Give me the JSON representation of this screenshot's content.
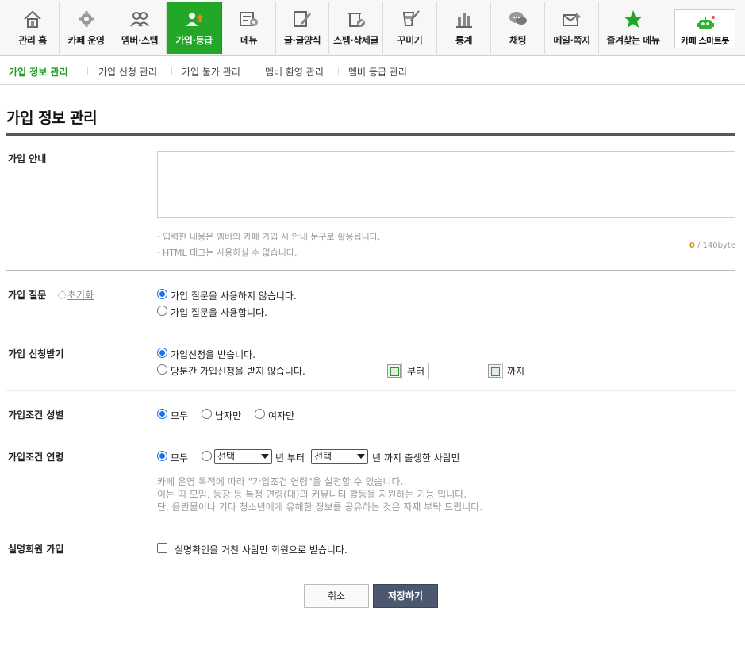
{
  "topnav": {
    "items": [
      {
        "label": "관리 홈",
        "icon": "home-icon"
      },
      {
        "label": "카페 운영",
        "icon": "gear-icon"
      },
      {
        "label": "멤버·스탭",
        "icon": "members-icon"
      },
      {
        "label": "가입·등급",
        "icon": "user-up-icon",
        "active": true
      },
      {
        "label": "메뉴",
        "icon": "menu-settings-icon"
      },
      {
        "label": "글·글양식",
        "icon": "pencil-icon"
      },
      {
        "label": "스팸·삭제글",
        "icon": "trash-icon"
      },
      {
        "label": "꾸미기",
        "icon": "paint-icon"
      },
      {
        "label": "통계",
        "icon": "bar-chart-icon"
      },
      {
        "label": "채팅",
        "icon": "chat-icon"
      },
      {
        "label": "메일·쪽지",
        "icon": "mail-icon"
      },
      {
        "label": "즐겨찾는 메뉴",
        "icon": "star-icon"
      }
    ],
    "smartbot": {
      "label": "카페 스마트봇",
      "icon": "robot-icon"
    },
    "active_color": "#22a826"
  },
  "subnav": {
    "items": [
      "가입 정보 관리",
      "가입 신청 관리",
      "가입 불가 관리",
      "멤버 환영 관리",
      "멤버 등급 관리"
    ],
    "active_index": 0,
    "active_color": "#1f9b22"
  },
  "page": {
    "title": "가입 정보 관리"
  },
  "join_guide": {
    "label": "가입 안내",
    "notes": [
      "· 입력한 내용은 멤버의 카페 가입 시 안내 문구로 활용됩니다.",
      "· HTML 태그는 사용하실 수 없습니다."
    ],
    "byte_count": "0",
    "byte_limit": " / 140byte"
  },
  "join_question": {
    "label": "가입 질문",
    "reset_icon": "refresh-icon",
    "reset_label": "초기화",
    "options": [
      "가입 질문을 사용하지 않습니다.",
      "가입 질문을 사용합니다."
    ],
    "selected": 0
  },
  "join_apply": {
    "label": "가입 신청받기",
    "options": [
      "가입신청을 받습니다.",
      "당분간 가입신청을 받지 않습니다."
    ],
    "selected": 0,
    "from_label": "부터",
    "to_label": "까지",
    "from_date": "",
    "to_date": ""
  },
  "gender": {
    "label": "가입조건 성별",
    "options": [
      "모두",
      "남자만",
      "여자만"
    ],
    "selected": 0
  },
  "age": {
    "label": "가입조건 연령",
    "options": [
      "모두"
    ],
    "selected": 0,
    "select_start": "선택",
    "select_end": "선택",
    "text_from": "년 부터",
    "text_to": "년 까지 출생한 사람만",
    "notes": [
      "카페 운영 목적에 따라 \"가입조건 연령\"을 설정할 수 있습니다.",
      "이는 띠 모임, 동창 등 특정 연령(대)의 커뮤니티 활동을 지원하는 기능 입니다.",
      "단, 음란물이나 기타 청소년에게 유해한 정보를 공유하는 것은 자제 부탁 드립니다."
    ]
  },
  "real_name": {
    "label": "실명회원 가입",
    "checkbox_label": "실명확인을 거친 사람만 회원으로 받습니다.",
    "checked": false
  },
  "actions": {
    "cancel": "취소",
    "save": "저장하기"
  }
}
